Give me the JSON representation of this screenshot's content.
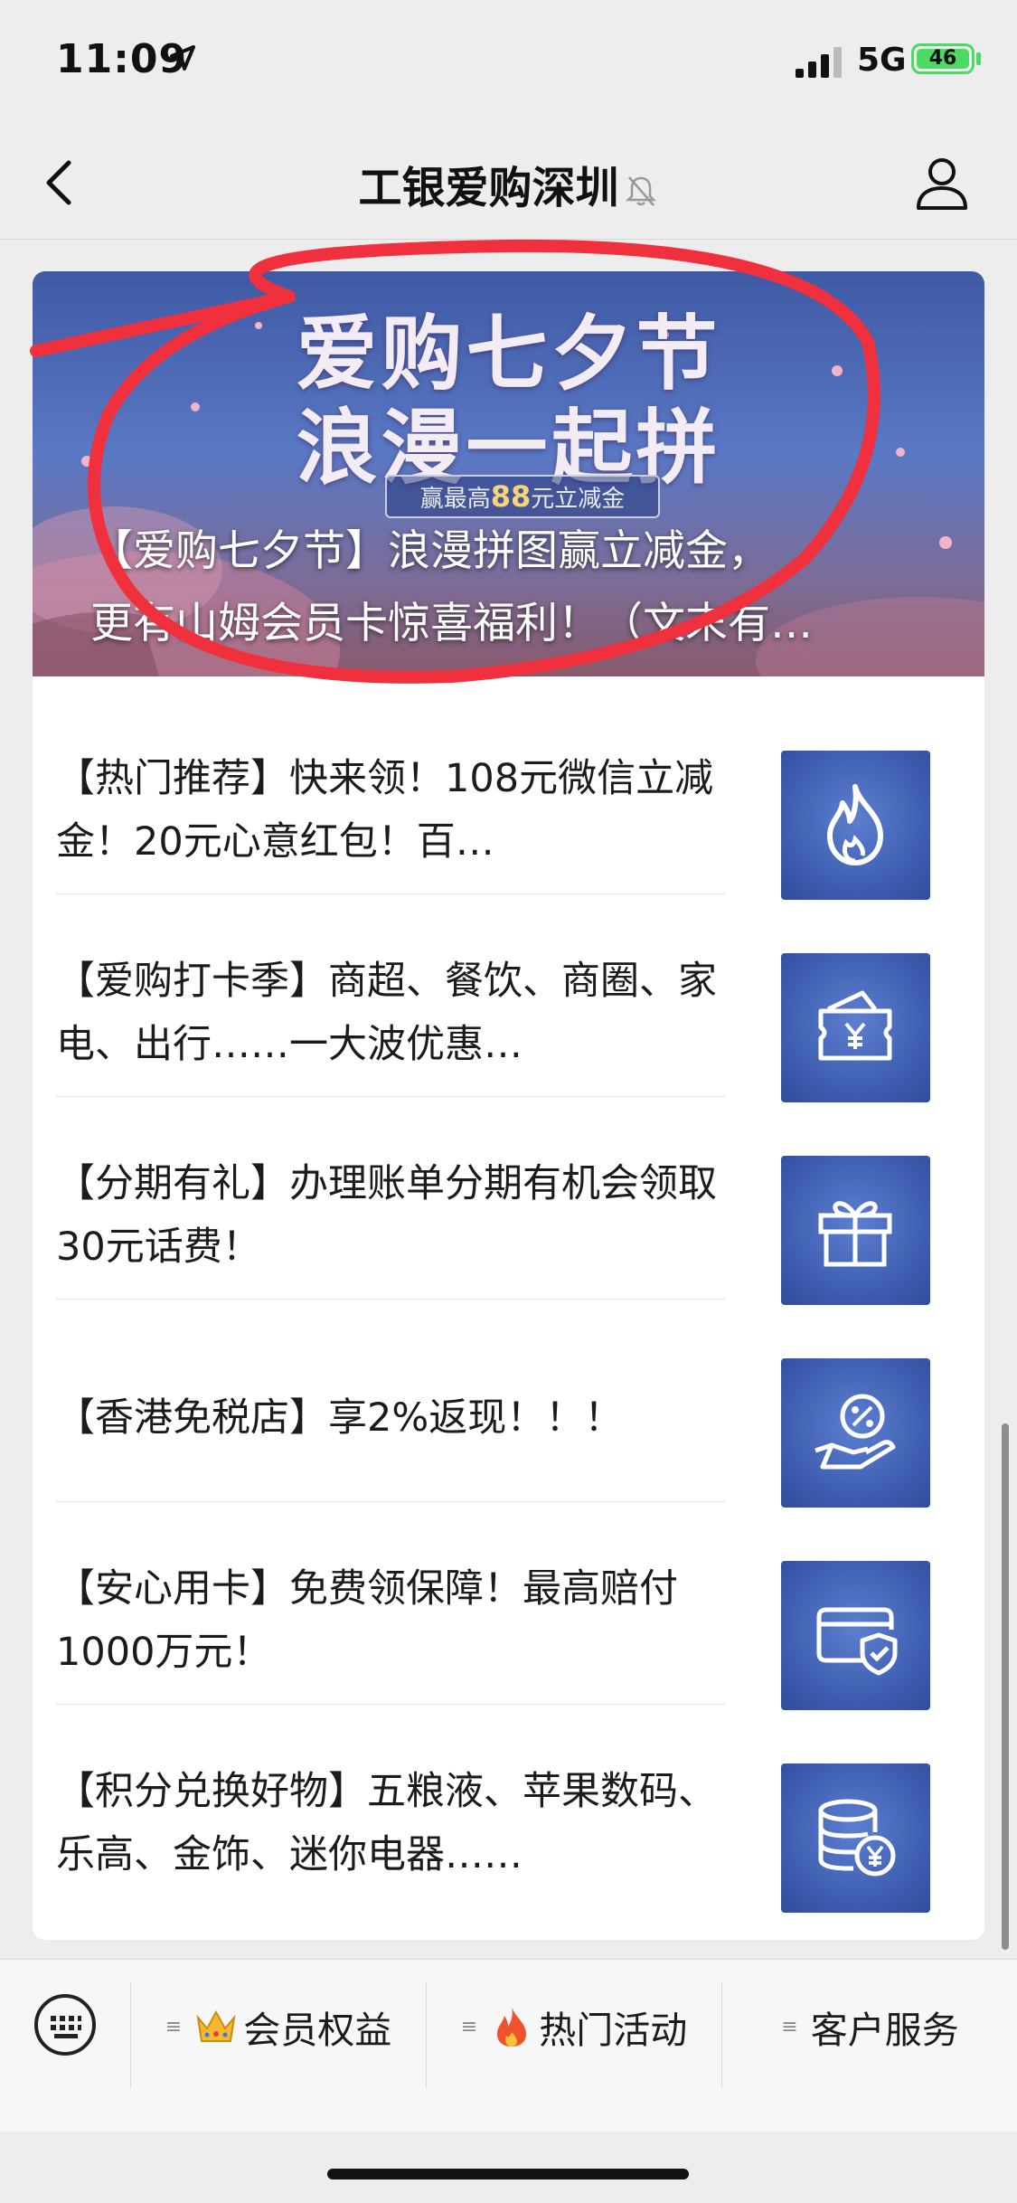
{
  "status_bar": {
    "time": "11:09",
    "network": "5G",
    "battery": "46"
  },
  "nav": {
    "title": "工银爱购深圳"
  },
  "banner": {
    "title_line1": "爱购七夕节",
    "title_line2": "浪漫一起拼",
    "badge_prefix": "赢最高",
    "badge_amount": "88",
    "badge_suffix": "元立减金",
    "caption_line1": "【爱购七夕节】浪漫拼图赢立减金，",
    "caption_line2": "更有山姆会员卡惊喜福利！（文末有…"
  },
  "articles": [
    {
      "text": "【热门推荐】快来领！108元微信立减金！20元心意红包！百…",
      "icon": "flame-icon"
    },
    {
      "text": "【爱购打卡季】商超、餐饮、商圈、家电、出行……一大波优惠…",
      "icon": "wallet-yuan-icon"
    },
    {
      "text": "【分期有礼】办理账单分期有机会领取30元话费！",
      "icon": "gift-icon"
    },
    {
      "text": "【香港免税店】享2%返现！！！",
      "icon": "percent-hand-icon"
    },
    {
      "text": "【安心用卡】免费领保障！最高赔付1000万元！",
      "icon": "card-shield-icon"
    },
    {
      "text": "【积分兑换好物】五粮液、苹果数码、乐高、金饰、迷你电器……",
      "icon": "coin-stack-icon"
    }
  ],
  "bottom_menu": [
    {
      "label": "会员权益",
      "icon": "crown-icon"
    },
    {
      "label": "热门活动",
      "icon": "fire-emoji-icon"
    },
    {
      "label": "客户服务",
      "icon": ""
    }
  ],
  "colors": {
    "accent_blue": "#3b5aad",
    "annotation_red": "#f0303c",
    "battery_green": "#4cd964"
  }
}
